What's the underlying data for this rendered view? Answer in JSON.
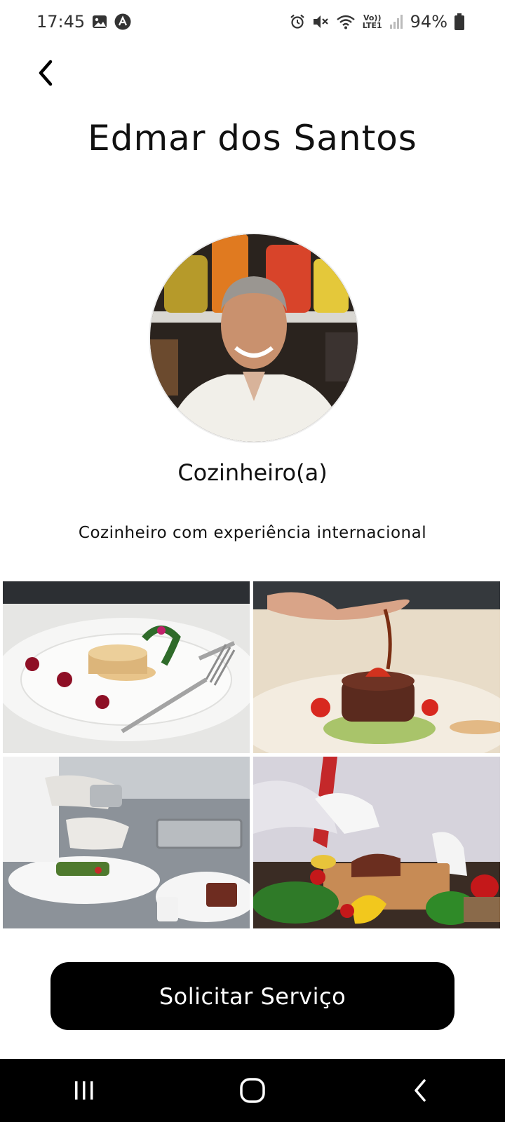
{
  "status_bar": {
    "time": "17:45",
    "left_icons": [
      "image-icon",
      "app-badge-icon"
    ],
    "right_icons": [
      "alarm-icon",
      "mute-icon",
      "wifi-icon",
      "volte-icon",
      "signal-icon",
      "battery-icon"
    ],
    "volte_line1": "Vo))",
    "volte_line2": "LTE1",
    "battery": "94%"
  },
  "header": {
    "back_icon": "chevron-left-icon",
    "title": "Edmar dos Santos"
  },
  "profile": {
    "role": "Cozinheiro(a)",
    "description": "Cozinheiro com experiência internacional"
  },
  "gallery": {
    "photos": [
      "plated-foie-gras-photo",
      "beef-sauce-pour-photo",
      "chef-plating-photo",
      "chef-vegetables-photo"
    ]
  },
  "actions": {
    "request_label": "Solicitar Serviço"
  },
  "nav_bar": {
    "icons": [
      "recent-apps-icon",
      "home-icon",
      "back-icon"
    ]
  },
  "colors": {
    "primary": "#000000",
    "background": "#ffffff",
    "text": "#111111"
  }
}
